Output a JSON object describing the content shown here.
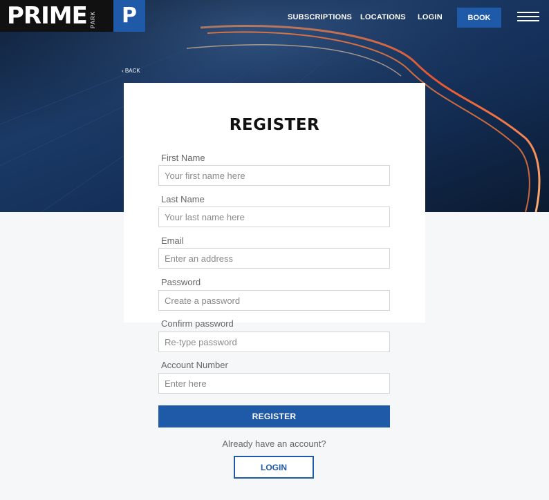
{
  "brand": {
    "name": "PRIME",
    "sub": "PARK",
    "mark": "P",
    "primary_color": "#1e5aa8"
  },
  "nav": {
    "items": [
      "SUBSCRIPTIONS",
      "LOCATIONS",
      "LOGIN"
    ],
    "book_label": "BOOK",
    "menu_icon": "hamburger-menu-icon"
  },
  "back": {
    "label": "‹ BACK"
  },
  "form": {
    "title": "REGISTER",
    "fields": [
      {
        "label": "First Name",
        "placeholder": "Your first name here"
      },
      {
        "label": "Last Name",
        "placeholder": "Your last name here"
      },
      {
        "label": "Email",
        "placeholder": "Enter an address"
      },
      {
        "label": "Password",
        "placeholder": "Create a password"
      },
      {
        "label": "Confirm password",
        "placeholder": "Re-type password"
      },
      {
        "label": "Account Number",
        "placeholder": "Enter here"
      }
    ],
    "submit_label": "REGISTER",
    "already_text": "Already have an account?",
    "login_label": "LOGIN"
  }
}
